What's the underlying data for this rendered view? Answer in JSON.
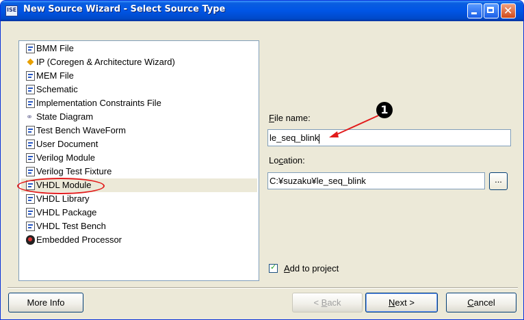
{
  "window": {
    "title": "New Source Wizard - Select Source Type",
    "icon_text": "ISE"
  },
  "source_types": [
    {
      "label": "BMM File",
      "icon": "bmm-file-icon"
    },
    {
      "label": "IP (Coregen & Architecture Wizard)",
      "icon": "ip-core-icon"
    },
    {
      "label": "MEM File",
      "icon": "mem-file-icon"
    },
    {
      "label": "Schematic",
      "icon": "schematic-icon"
    },
    {
      "label": "Implementation Constraints File",
      "icon": "constraints-file-icon"
    },
    {
      "label": "State Diagram",
      "icon": "state-diagram-icon"
    },
    {
      "label": "Test Bench WaveForm",
      "icon": "waveform-icon"
    },
    {
      "label": "User Document",
      "icon": "document-icon"
    },
    {
      "label": "Verilog Module",
      "icon": "verilog-module-icon"
    },
    {
      "label": "Verilog Test Fixture",
      "icon": "verilog-fixture-icon"
    },
    {
      "label": "VHDL Module",
      "icon": "vhdl-module-icon",
      "selected": true
    },
    {
      "label": "VHDL Library",
      "icon": "vhdl-library-icon"
    },
    {
      "label": "VHDL Package",
      "icon": "vhdl-package-icon"
    },
    {
      "label": "VHDL Test Bench",
      "icon": "vhdl-testbench-icon"
    },
    {
      "label": "Embedded Processor",
      "icon": "processor-icon"
    }
  ],
  "form": {
    "file_name_label_access": "F",
    "file_name_label_rest": "ile name:",
    "file_name_value": "le_seq_blink",
    "location_label_pre": "Lo",
    "location_label_access": "c",
    "location_label_rest": "ation:",
    "location_value": "C:¥suzaku¥le_seq_blink",
    "browse_label": "...",
    "add_to_project_access": "A",
    "add_to_project_rest": "dd to project",
    "add_to_project_checked": true
  },
  "buttons": {
    "more_info": "More Info",
    "back_pre": "< ",
    "back_access": "B",
    "back_rest": "ack",
    "next_access": "N",
    "next_rest": "ext >",
    "cancel_access": "C",
    "cancel_rest": "ancel"
  },
  "annotation": {
    "badge": "1",
    "color": "#e21b1b"
  }
}
